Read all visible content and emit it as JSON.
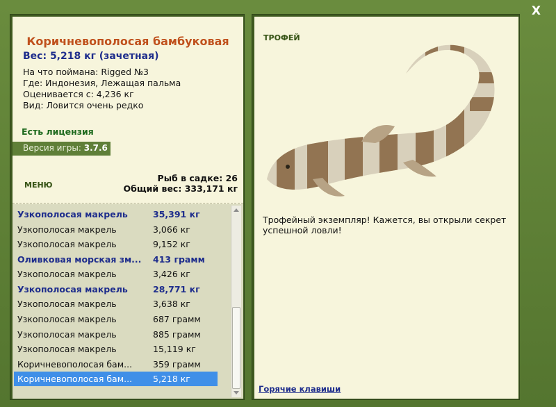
{
  "window": {
    "close_label": "X"
  },
  "catch": {
    "title": "Коричневополосая бамбуковая",
    "weight": "Вес: 5,218 кг (зачетная)",
    "info": [
      "На что поймана: Rigged №3",
      "Где: Индонезия, Лежащая пальма",
      "Оценивается с: 4,236 кг",
      "Вид: Ловится очень редко"
    ]
  },
  "license": "Есть лицензия",
  "version": {
    "label": "Версия игры:",
    "value": "3.7.6"
  },
  "menu_label": "МЕНЮ",
  "keep": {
    "count_line": "Рыб в садке: 26",
    "total_line": "Общий вес: 333,171 кг"
  },
  "fish_list": [
    {
      "name": "Узкополосая макрель",
      "weight": "35,391 кг",
      "trophy": true,
      "selected": false
    },
    {
      "name": "Узкополосая макрель",
      "weight": "3,066 кг",
      "trophy": false,
      "selected": false
    },
    {
      "name": "Узкополосая макрель",
      "weight": "9,152 кг",
      "trophy": false,
      "selected": false
    },
    {
      "name": "Оливковая морская зм...",
      "weight": "413 грамм",
      "trophy": true,
      "selected": false
    },
    {
      "name": "Узкополосая макрель",
      "weight": "3,426 кг",
      "trophy": false,
      "selected": false
    },
    {
      "name": "Узкополосая макрель",
      "weight": "28,771 кг",
      "trophy": true,
      "selected": false
    },
    {
      "name": "Узкополосая макрель",
      "weight": "3,638 кг",
      "trophy": false,
      "selected": false
    },
    {
      "name": "Узкополосая макрель",
      "weight": "687 грамм",
      "trophy": false,
      "selected": false
    },
    {
      "name": "Узкополосая макрель",
      "weight": "885 грамм",
      "trophy": false,
      "selected": false
    },
    {
      "name": "Узкополосая макрель",
      "weight": "15,119 кг",
      "trophy": false,
      "selected": false
    },
    {
      "name": "Коричневополосая бам...",
      "weight": "359 грамм",
      "trophy": false,
      "selected": false
    },
    {
      "name": "Коричневополосая бам...",
      "weight": "5,218 кг",
      "trophy": false,
      "selected": true
    }
  ],
  "trophy_panel": {
    "label": "ТРОФЕЙ",
    "description": "Трофейный экземпляр! Кажется, вы открыли секрет успешной ловли!",
    "hotkeys": "Горячие клавиши"
  },
  "colors": {
    "frame": "#5d7f37",
    "panel_bg": "#f7f5dc",
    "list_bg": "#dadbc0",
    "trophy_text": "#1e2d8c",
    "title_text": "#c0511d",
    "selected_bg": "#3f8fe8",
    "license_text": "#1f6b1f"
  }
}
